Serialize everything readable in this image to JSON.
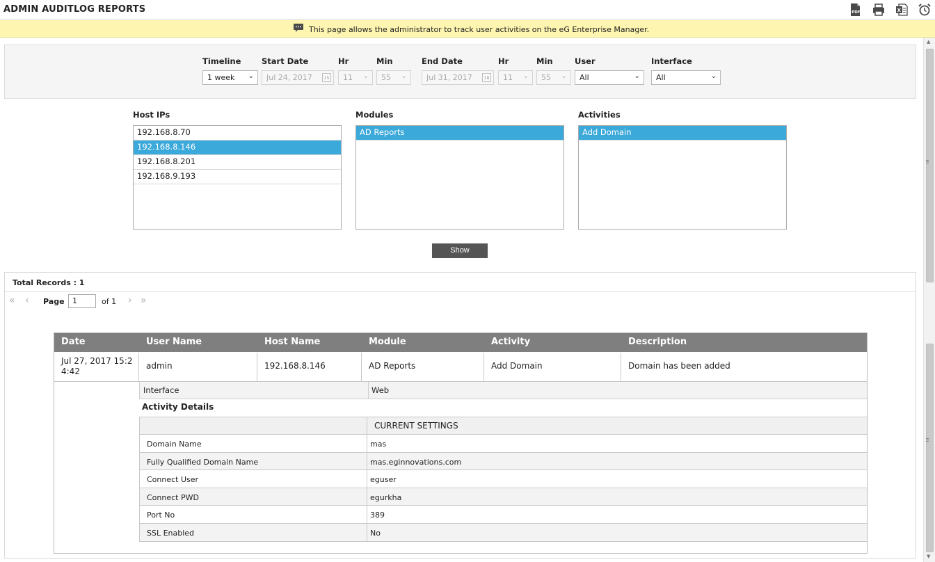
{
  "header": {
    "title": "ADMIN AUDITLOG REPORTS",
    "icons": [
      "pdf-icon",
      "print-icon",
      "excel-icon",
      "alarm-icon"
    ]
  },
  "info": {
    "text": "This page allows the administrator to track user activities on the eG Enterprise Manager."
  },
  "filters": {
    "timeline_label": "Timeline",
    "timeline_value": "1 week",
    "start_date_label": "Start Date",
    "start_date_value": "Jul 24, 2017",
    "start_hr_label": "Hr",
    "start_hr_value": "11",
    "start_min_label": "Min",
    "start_min_value": "55",
    "end_date_label": "End Date",
    "end_date_value": "Jul 31, 2017",
    "end_hr_label": "Hr",
    "end_hr_value": "11",
    "end_min_label": "Min",
    "end_min_value": "55",
    "user_label": "User",
    "user_value": "All",
    "interface_label": "Interface",
    "interface_value": "All",
    "start_cal_day": "15",
    "end_cal_day": "18"
  },
  "lists": {
    "host_ips_label": "Host IPs",
    "host_ips": [
      "192.168.8.70",
      "192.168.8.146",
      "192.168.8.201",
      "192.168.9.193"
    ],
    "host_ips_selected": "192.168.8.146",
    "modules_label": "Modules",
    "modules": [
      "AD Reports"
    ],
    "activities_label": "Activities",
    "activities": [
      "Add Domain"
    ]
  },
  "show_button": "Show",
  "results": {
    "total_records": "Total Records : 1",
    "page_label": "Page",
    "page_value": "1",
    "page_of": "of 1"
  },
  "grid": {
    "columns": [
      "Date",
      "User Name",
      "Host Name",
      "Module",
      "Activity",
      "Description"
    ],
    "row": {
      "date_line1": "Jul 27, 2017 15:2",
      "date_line2": "4:42",
      "user": "admin",
      "host": "192.168.8.146",
      "module": "AD Reports",
      "activity": "Add Domain",
      "description": "Domain has been added"
    },
    "interface_label": "Interface",
    "interface_value": "Web",
    "activity_details_label": "Activity Details",
    "settings_header": "CURRENT SETTINGS",
    "settings": [
      {
        "key": "Domain Name",
        "value": "mas"
      },
      {
        "key": "Fully Qualified Domain Name",
        "value": "mas.eginnovations.com"
      },
      {
        "key": "Connect User",
        "value": "eguser"
      },
      {
        "key": "Connect PWD",
        "value": "egurkha"
      },
      {
        "key": "Port No",
        "value": "389"
      },
      {
        "key": "SSL Enabled",
        "value": "No"
      }
    ]
  },
  "colors": {
    "info_bar": "#fdf5b0",
    "selected": "#3ba9d9",
    "grid_header": "#7f7f7f",
    "show_button": "#555555"
  }
}
